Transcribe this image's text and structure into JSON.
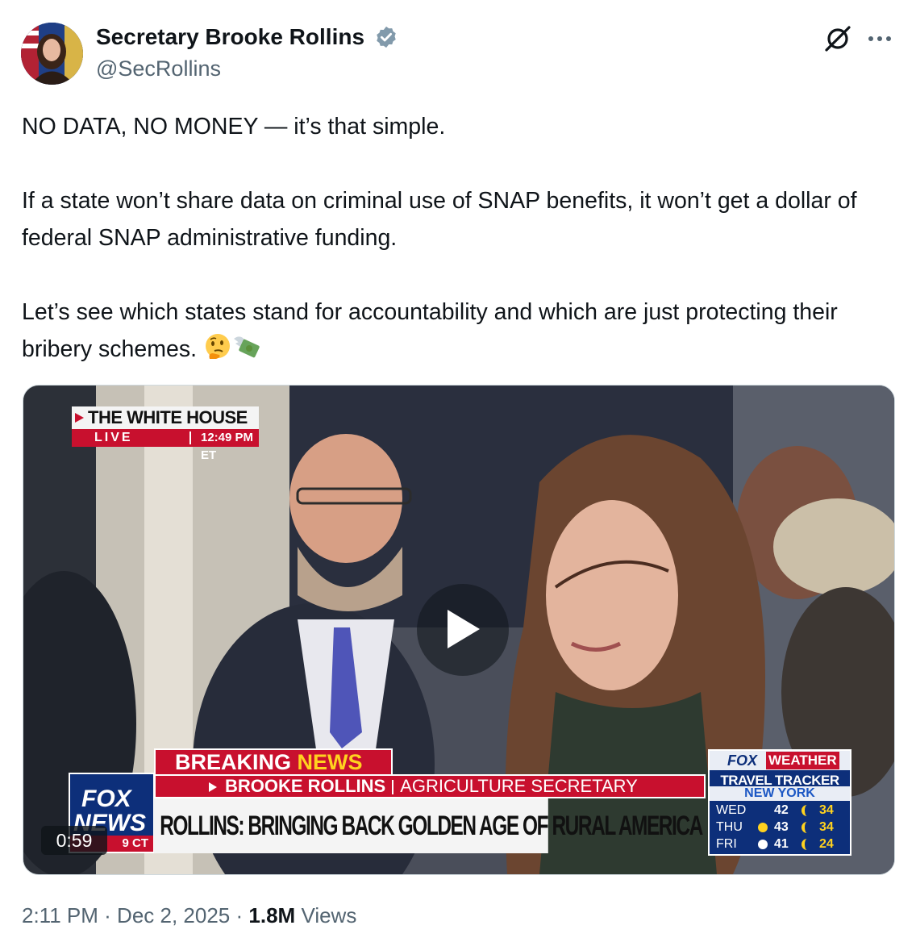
{
  "author": {
    "name": "Secretary Brooke Rollins",
    "handle": "@SecRollins",
    "verified_badge_color": "#829aab"
  },
  "icons": {
    "grok": "grok-icon",
    "more": "more-options-icon",
    "verified": "verified-badge-icon",
    "play": "play-icon"
  },
  "tweet": {
    "line1": "NO DATA, NO MONEY — it’s that simple.",
    "line2": "If a state won’t share data on criminal use of SNAP benefits, it won’t get a dollar of federal SNAP administrative funding.",
    "line3": "Let’s see which states stand for accountability and which are just protecting their bribery schemes.",
    "emojis": [
      "thinking-face-emoji",
      "money-with-wings-emoji"
    ]
  },
  "video": {
    "duration": "0:59",
    "location_bug": {
      "title": "THE WHITE HOUSE",
      "live": "LIVE",
      "time": "12:49 PM ET"
    },
    "network": {
      "line1": "FOX",
      "line2": "NEWS",
      "clock_fragment": "9 CT"
    },
    "lower_third": {
      "breaking": "BREAKING",
      "news": "NEWS",
      "name": "BROOKE ROLLINS",
      "role": "AGRICULTURE SECRETARY",
      "headline": "ROLLINS: BRINGING BACK GOLDEN AGE OF RURAL AMERICA"
    },
    "weather": {
      "brand_fox": "FOX",
      "brand_weather": "WEATHER",
      "tracker": "TRAVEL TRACKER",
      "city": "NEW YORK",
      "days": [
        {
          "day": "WED",
          "hi": "42",
          "lo": "34"
        },
        {
          "day": "THU",
          "hi": "43",
          "lo": "34"
        },
        {
          "day": "FRI",
          "hi": "41",
          "lo": "24"
        }
      ]
    }
  },
  "meta": {
    "time": "2:11 PM",
    "dot1": "·",
    "date": "Dec 2, 2025",
    "dot2": "·",
    "views_count": "1.8M",
    "views_label": "Views"
  }
}
